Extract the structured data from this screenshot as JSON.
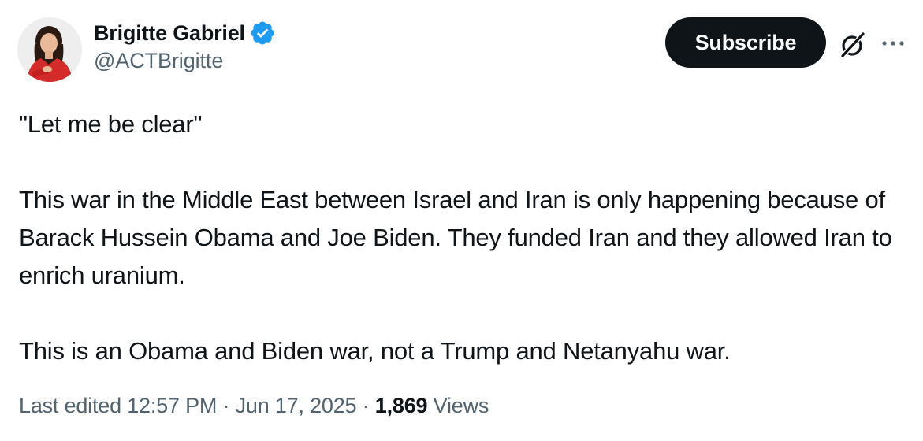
{
  "author": {
    "display_name": "Brigitte Gabriel",
    "handle": "@ACTBrigitte",
    "verified": true,
    "verified_color": "#1d9bf0"
  },
  "actions": {
    "subscribe_label": "Subscribe",
    "grok_icon": "grok-icon",
    "more_icon": "more-horizontal-icon"
  },
  "tweet": {
    "paragraphs": [
      "\"Let me be clear\"",
      "This war in the Middle East between Israel and Iran is only happening because of Barack Hussein Obama and Joe Biden. They funded Iran and they allowed Iran to enrich uranium.",
      "This is an Obama and Biden war, not a Trump and Netanyahu war."
    ]
  },
  "meta": {
    "edited_label": "Last edited",
    "time": "12:57 PM",
    "separator": "·",
    "date": "Jun 17, 2025",
    "views_count": "1,869",
    "views_label": "Views"
  },
  "colors": {
    "text_primary": "#0f1419",
    "text_secondary": "#536471",
    "button_bg": "#0f1419",
    "button_text": "#ffffff"
  }
}
